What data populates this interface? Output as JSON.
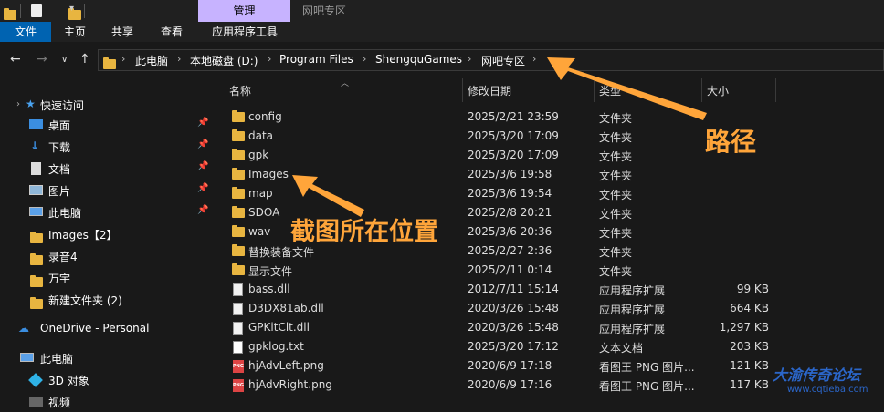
{
  "titlebar": {
    "context_tab": "管理",
    "window_title": "网吧专区"
  },
  "ribbon": {
    "tabs": [
      "文件",
      "主页",
      "共享",
      "查看",
      "应用程序工具"
    ]
  },
  "address": {
    "crumbs": [
      "此电脑",
      "本地磁盘 (D:)",
      "Program Files",
      "ShengquGames",
      "网吧专区"
    ]
  },
  "nav": {
    "quick_access": "快速访问",
    "items": [
      {
        "label": "桌面",
        "icon": "desktop-icon",
        "pinned": true
      },
      {
        "label": "下载",
        "icon": "download-icon",
        "pinned": true
      },
      {
        "label": "文档",
        "icon": "document-icon",
        "pinned": true
      },
      {
        "label": "图片",
        "icon": "picture-icon",
        "pinned": true
      },
      {
        "label": "此电脑",
        "icon": "computer-icon",
        "pinned": true
      },
      {
        "label": "Images【2】",
        "icon": "folder-icon",
        "pinned": false
      },
      {
        "label": "录音4",
        "icon": "folder-icon",
        "pinned": false
      },
      {
        "label": "万宇",
        "icon": "folder-icon",
        "pinned": false
      },
      {
        "label": "新建文件夹 (2)",
        "icon": "folder-icon",
        "pinned": false
      }
    ],
    "onedrive": "OneDrive - Personal",
    "this_pc": "此电脑",
    "objects3d": "3D 对象",
    "video": "视频"
  },
  "columns": {
    "name": "名称",
    "date": "修改日期",
    "type": "类型",
    "size": "大小"
  },
  "files": [
    {
      "name": "config",
      "date": "2025/2/21 23:59",
      "type": "文件夹",
      "size": "",
      "icon": "folder-icon"
    },
    {
      "name": "data",
      "date": "2025/3/20 17:09",
      "type": "文件夹",
      "size": "",
      "icon": "folder-icon"
    },
    {
      "name": "gpk",
      "date": "2025/3/20 17:09",
      "type": "文件夹",
      "size": "",
      "icon": "folder-icon"
    },
    {
      "name": "Images",
      "date": "2025/3/6 19:58",
      "type": "文件夹",
      "size": "",
      "icon": "folder-icon"
    },
    {
      "name": "map",
      "date": "2025/3/6 19:54",
      "type": "文件夹",
      "size": "",
      "icon": "folder-icon"
    },
    {
      "name": "SDOA",
      "date": "2025/2/8 20:21",
      "type": "文件夹",
      "size": "",
      "icon": "folder-icon"
    },
    {
      "name": "wav",
      "date": "2025/3/6 20:36",
      "type": "文件夹",
      "size": "",
      "icon": "folder-icon"
    },
    {
      "name": "替换装备文件",
      "date": "2025/2/27 2:36",
      "type": "文件夹",
      "size": "",
      "icon": "folder-icon"
    },
    {
      "name": "显示文件",
      "date": "2025/2/11 0:14",
      "type": "文件夹",
      "size": "",
      "icon": "folder-icon"
    },
    {
      "name": "bass.dll",
      "date": "2012/7/11 15:14",
      "type": "应用程序扩展",
      "size": "99 KB",
      "icon": "dll-file-icon"
    },
    {
      "name": "D3DX81ab.dll",
      "date": "2020/3/26 15:48",
      "type": "应用程序扩展",
      "size": "664 KB",
      "icon": "dll-file-icon"
    },
    {
      "name": "GPKitClt.dll",
      "date": "2020/3/26 15:48",
      "type": "应用程序扩展",
      "size": "1,297 KB",
      "icon": "dll-file-icon"
    },
    {
      "name": "gpklog.txt",
      "date": "2025/3/20 17:12",
      "type": "文本文档",
      "size": "203 KB",
      "icon": "text-file-icon"
    },
    {
      "name": "hjAdvLeft.png",
      "date": "2020/6/9 17:18",
      "type": "看图王 PNG 图片...",
      "size": "121 KB",
      "icon": "png-file-icon"
    },
    {
      "name": "hjAdvRight.png",
      "date": "2020/6/9 17:16",
      "type": "看图王 PNG 图片...",
      "size": "117 KB",
      "icon": "png-file-icon"
    }
  ],
  "annotations": {
    "path": "路径",
    "screenshot_location": "截图所在位置"
  },
  "watermark": {
    "main": "大渝传奇论坛",
    "sub": "www.cqtieba.com"
  },
  "colors": {
    "accent": "#0063b1",
    "context_tab": "#c7b3ff",
    "annotation": "#ffa53a",
    "folder": "#e8b540"
  }
}
